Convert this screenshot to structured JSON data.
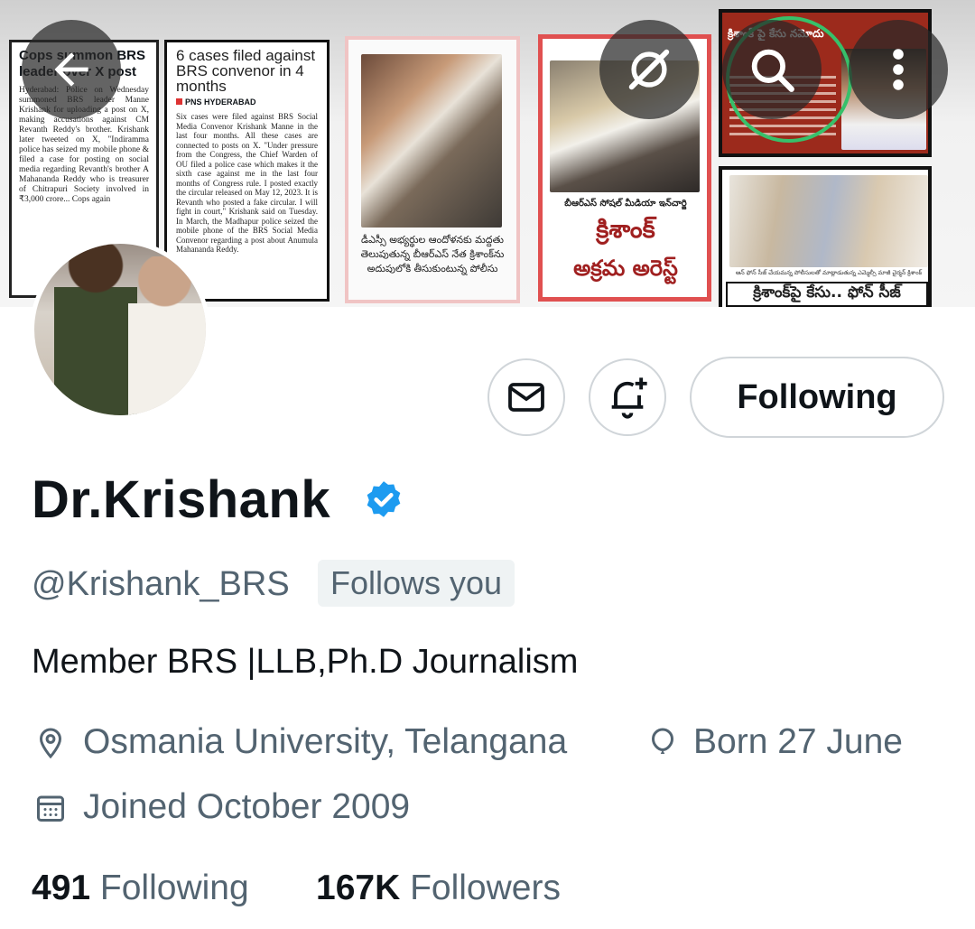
{
  "header": {
    "back_icon": "arrow-left-icon",
    "grok_icon": "grok-icon",
    "search_icon": "search-icon",
    "more_icon": "more-vertical-icon"
  },
  "banner": {
    "clip1": {
      "headline": "Cops summon BRS leader over X post",
      "body": "Hyderabad: Police on Wednesday summoned BRS leader Manne Krishank for uploading a post on X, making accusations against CM Revanth Reddy's brother. Krishank later tweeted on X, \"Indiramma police has seized my mobile phone & filed a case for posting on social media regarding Revanth's brother A Mahananda Reddy who is treasurer of Chitrapuri Society involved in ₹3,000 crore... Cops again"
    },
    "clip2": {
      "headline": "6 cases filed against BRS convenor in 4 months",
      "byline": "PNS HYDERABAD",
      "body": "Six cases were filed against BRS Social Media Convenor Krishank Manne in the last four months. All these cases are connected to posts on X. \"Under pressure from the Congress, the Chief Warden of OU filed a police case which makes it the sixth case against me in the last four months of Congress rule. I posted exactly the circular released on May 12, 2023. It is Revanth who posted a fake circular. I will fight in court,\" Krishank said on Tuesday. In March, the Madhapur police seized the mobile phone of the BRS Social Media Convenor regarding a post about Anumula Mahananda Reddy."
    },
    "clip3": {
      "caption": "డీఎస్సీ అభ్యర్థుల ఆందోళనకు మద్దతు తెలుపుతున్న బీఆర్ఎస్ నేత క్రిశాంక్‌ను అదుపులోకి తీసుకుంటున్న పోలీసు"
    },
    "clip4": {
      "subtitle": "బీఆర్ఎస్ సోషల్ మీడియా ఇన్‌చార్జి",
      "title_line1": "క్రిశాంక్",
      "title_line2": "అక్రమ అరెస్ట్"
    },
    "clip5": {
      "headline": "క్రిశాంక్ పై కేసు నమోదు"
    },
    "clip6": {
      "small_caption": "ఆన్ ఫోన్ సీజ్ చేయమన్న పోలీసులతో మాట్లాడుతున్న ఎమ్మెల్సీ మాజీ చైర్మన్ క్రిశాంక్",
      "headline": "క్రిశాంక్‌పై కేసు.. ఫోన్ సీజ్"
    }
  },
  "actions": {
    "message_icon": "envelope-icon",
    "notify_icon": "bell-plus-icon",
    "follow_label": "Following"
  },
  "profile": {
    "name": "Dr.Krishank",
    "verified_icon": "verified-badge-icon",
    "handle": "@Krishank_BRS",
    "follows_you": "Follows you",
    "bio": "Member BRS |LLB,Ph.D Journalism",
    "location": "Osmania University, Telangana",
    "birthday": "Born 27 June",
    "joined": "Joined October 2009",
    "following_count": "491",
    "following_label": "Following",
    "followers_count": "167K",
    "followers_label": "Followers"
  },
  "colors": {
    "verified_blue": "#1d9bf0",
    "secondary_text": "#536471",
    "primary_text": "#0f1419"
  }
}
